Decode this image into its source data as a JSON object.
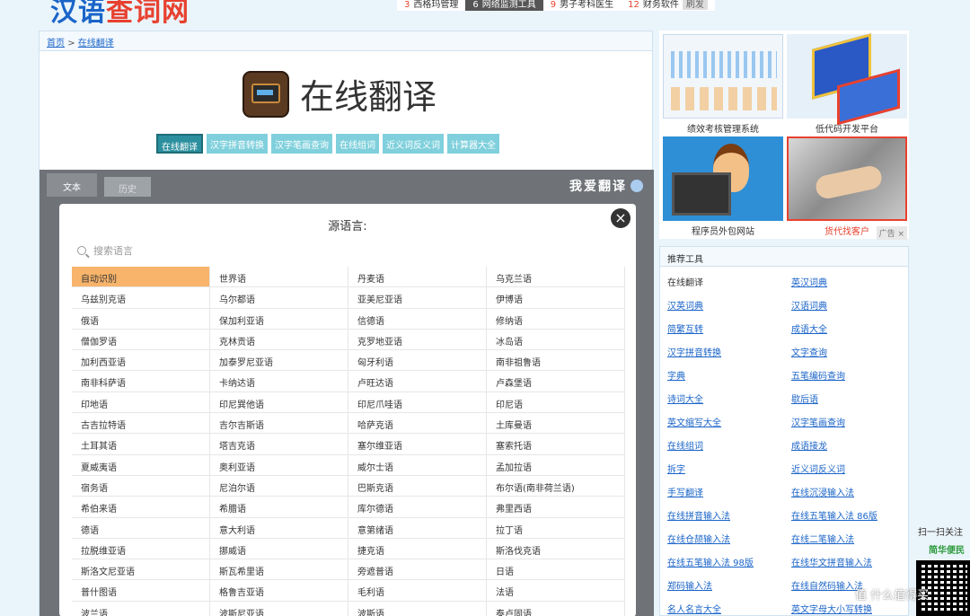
{
  "site": {
    "logo_part1": "汉语",
    "logo_part2": "查词网"
  },
  "hot_links": [
    {
      "n": "3",
      "label": "西格玛管理",
      "dark": false
    },
    {
      "n": "6",
      "label": "网络监测工具",
      "dark": true
    },
    {
      "n": "9",
      "label": "男子考科医生",
      "dark": false
    },
    {
      "n": "12",
      "label": "财务软件",
      "dark": false
    }
  ],
  "hot_close": "刷发",
  "breadcrumb": {
    "home": "首页",
    "sep": ">",
    "current": "在线翻译"
  },
  "page_title": "在线翻译",
  "tool_tabs": [
    "在线翻译",
    "汉字拼音转换",
    "汉字笔画查询",
    "在线组词",
    "近义词反义词",
    "计算器大全"
  ],
  "panel": {
    "tab_text": "文本",
    "tab_history": "历史",
    "brand": "我爱翻译",
    "modal_title": "源语言:",
    "close": "×",
    "search_placeholder": "搜索语言"
  },
  "languages": [
    "自动识别",
    "世界语",
    "丹麦语",
    "乌克兰语",
    "乌兹别克语",
    "乌尔都语",
    "亚美尼亚语",
    "伊博语",
    "俄语",
    "保加利亚语",
    "信德语",
    "修纳语",
    "僧伽罗语",
    "克林贡语",
    "克罗地亚语",
    "冰岛语",
    "加利西亚语",
    "加泰罗尼亚语",
    "匈牙利语",
    "南非祖鲁语",
    "南非科萨语",
    "卡纳达语",
    "卢旺达语",
    "卢森堡语",
    "印地语",
    "印尼巽他语",
    "印尼爪哇语",
    "印尼语",
    "古吉拉特语",
    "吉尔吉斯语",
    "哈萨克语",
    "土库曼语",
    "土耳其语",
    "塔吉克语",
    "塞尔维亚语",
    "塞索托语",
    "夏威夷语",
    "奥利亚语",
    "威尔士语",
    "孟加拉语",
    "宿务语",
    "尼泊尔语",
    "巴斯克语",
    "布尔语(南非荷兰语)",
    "希伯来语",
    "希腊语",
    "库尔德语",
    "弗里西语",
    "德语",
    "意大利语",
    "意第绪语",
    "拉丁语",
    "拉脱维亚语",
    "挪威语",
    "捷克语",
    "斯洛伐克语",
    "斯洛文尼亚语",
    "斯瓦希里语",
    "旁遮普语",
    "日语",
    "普什图语",
    "格鲁吉亚语",
    "毛利语",
    "法语",
    "波兰语",
    "波斯尼亚语",
    "波斯语",
    "泰卢固语"
  ],
  "ads": [
    {
      "caption": "绩效考核管理系统",
      "red": false
    },
    {
      "caption": "低代码开发平台",
      "red": false
    },
    {
      "caption": "程序员外包网站",
      "red": false
    },
    {
      "caption": "货代找客户",
      "red": true
    }
  ],
  "ad_close": "广告 ×",
  "tools_header": "推荐工具",
  "tools": [
    {
      "label": "在线翻译",
      "plain": true
    },
    {
      "label": "英汉词典",
      "plain": false
    },
    {
      "label": "汉英词典",
      "plain": false
    },
    {
      "label": "汉语词典",
      "plain": false
    },
    {
      "label": "简繁互转",
      "plain": false
    },
    {
      "label": "成语大全",
      "plain": false
    },
    {
      "label": "汉字拼音转换",
      "plain": false
    },
    {
      "label": "文字查询",
      "plain": false
    },
    {
      "label": "字典",
      "plain": false
    },
    {
      "label": "五笔编码查询",
      "plain": false
    },
    {
      "label": "诗词大全",
      "plain": false
    },
    {
      "label": "歇后语",
      "plain": false
    },
    {
      "label": "英文缩写大全",
      "plain": false
    },
    {
      "label": "汉字笔画查询",
      "plain": false
    },
    {
      "label": "在线组词",
      "plain": false
    },
    {
      "label": "成语接龙",
      "plain": false
    },
    {
      "label": "拆字",
      "plain": false
    },
    {
      "label": "近义词反义词",
      "plain": false
    },
    {
      "label": "手写翻译",
      "plain": false
    },
    {
      "label": "在线沉浸输入法",
      "plain": false
    },
    {
      "label": "在线拼音输入法",
      "plain": false
    },
    {
      "label": "在线五笔输入法 86版",
      "plain": false
    },
    {
      "label": "在线仓颉输入法",
      "plain": false
    },
    {
      "label": "在线二笔输入法",
      "plain": false
    },
    {
      "label": "在线五笔输入法 98版",
      "plain": false
    },
    {
      "label": "在线华文拼音输入法",
      "plain": false
    },
    {
      "label": "郑码输入法",
      "plain": false
    },
    {
      "label": "在线自然码输入法",
      "plain": false
    },
    {
      "label": "名人名言大全",
      "plain": false
    },
    {
      "label": "英文字母大小写转换",
      "plain": false
    }
  ],
  "follow_text": "扫一扫关注",
  "follow_brand": "简华便民",
  "watermark": "值 什么值得买"
}
